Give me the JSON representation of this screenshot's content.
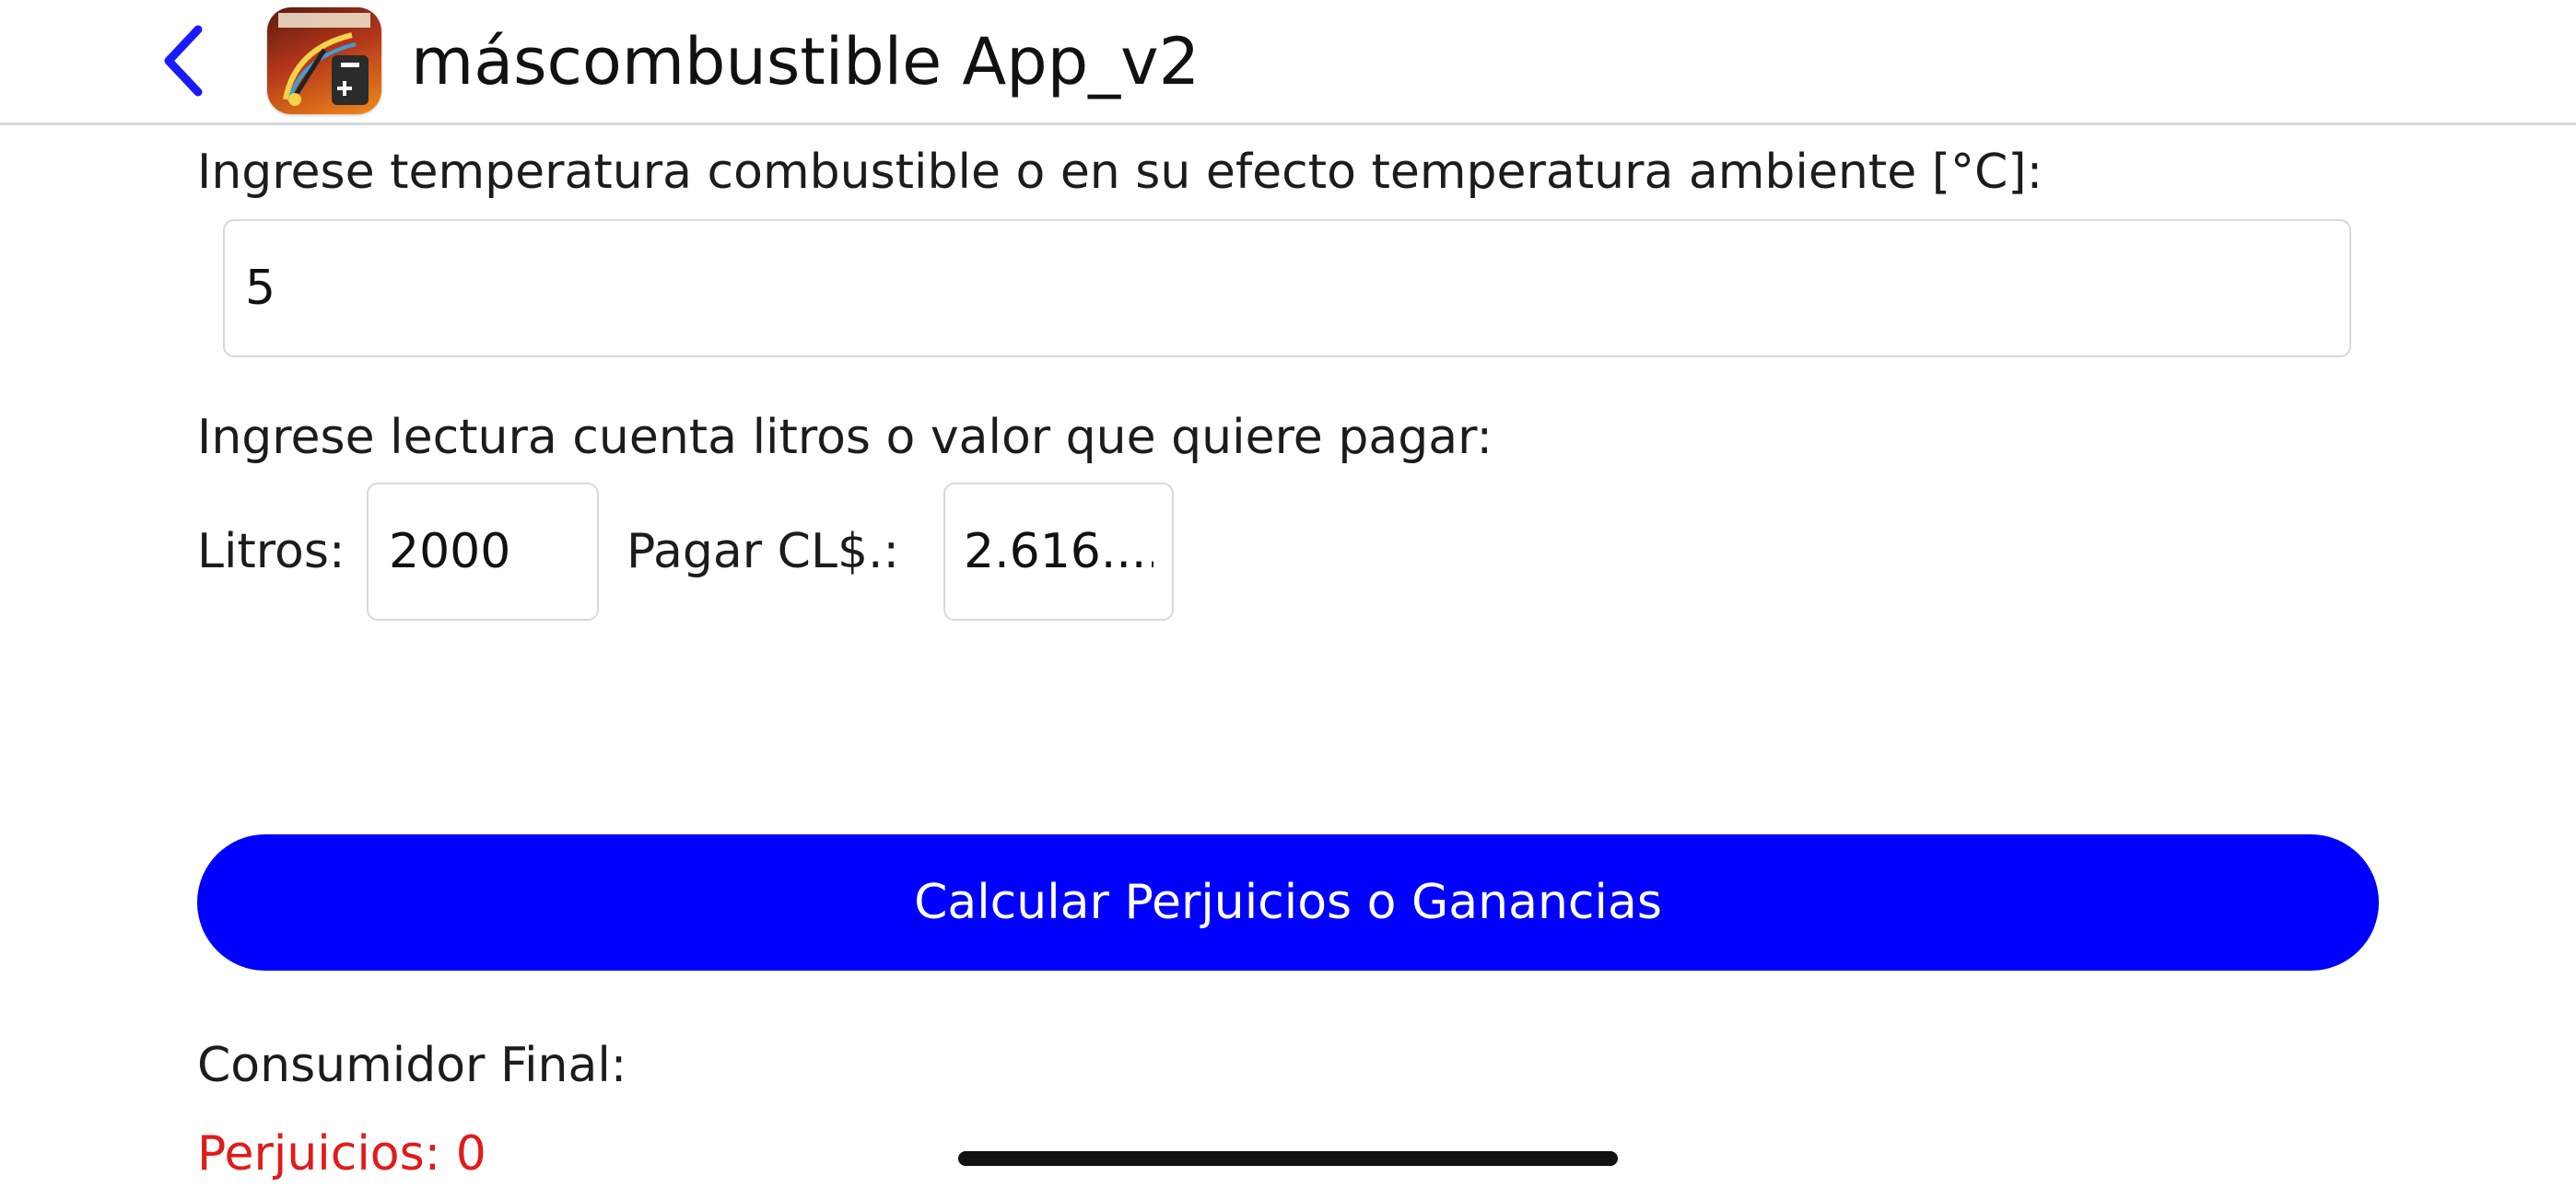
{
  "header": {
    "title": "máscombustible App_v2",
    "back_icon": "chevron-left-icon",
    "app_icon": "app-logo-icon"
  },
  "form": {
    "temperature_label": "Ingrese temperatura combustible o en su efecto temperatura ambiente [°C]:",
    "temperature_value": "5",
    "reading_label": "Ingrese lectura cuenta litros o valor que quiere pagar:",
    "liters_label": "Litros:",
    "liters_value": "2000",
    "pay_label": "Pagar CL$.:",
    "pay_value": "2.616...."
  },
  "actions": {
    "calculate_label": "Calcular Perjuicios o Ganancias"
  },
  "results": {
    "consumer_label": "Consumidor Final:",
    "losses_text": "Perjuicios: 0"
  },
  "colors": {
    "accent": "#0000ff",
    "loss": "#e01b1b"
  }
}
